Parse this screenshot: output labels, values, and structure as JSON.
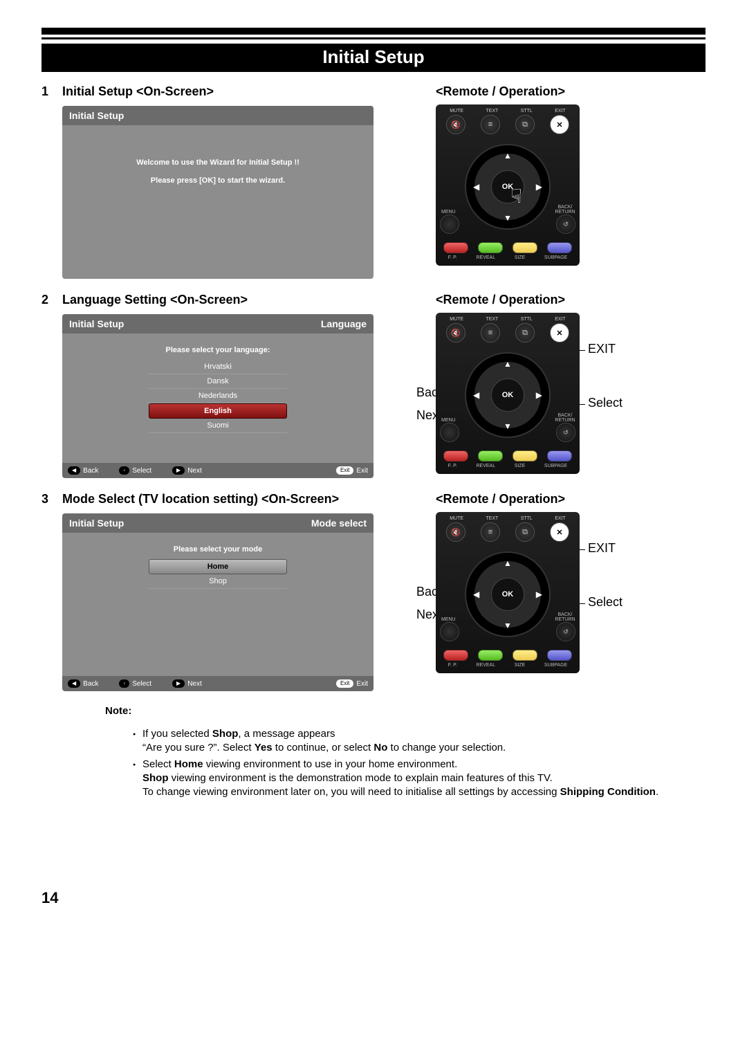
{
  "page_number": "14",
  "title_bar": "Initial Setup",
  "remote_heading": "<Remote / Operation>",
  "step1": {
    "num": "1",
    "heading": "Initial Setup <On-Screen>",
    "osd_title": "Initial Setup",
    "msg1": "Welcome to use the Wizard for Initial Setup !!",
    "msg2": "Please press [OK] to start the wizard."
  },
  "step2": {
    "num": "2",
    "heading": "Language Setting <On-Screen>",
    "osd_title": "Initial Setup",
    "osd_right": "Language",
    "prompt": "Please select your language:",
    "langs": [
      "Hrvatski",
      "Dansk",
      "Nederlands",
      "English",
      "Suomi"
    ],
    "selected": "English"
  },
  "step3": {
    "num": "3",
    "heading": "Mode Select (TV location setting) <On-Screen>",
    "osd_title": "Initial Setup",
    "osd_right": "Mode select",
    "prompt": "Please select your mode",
    "modes": [
      "Home",
      "Shop"
    ],
    "selected": "Home"
  },
  "osd_footer": {
    "back": "Back",
    "select": "Select",
    "next": "Next",
    "exit": "Exit",
    "exit_pill": "Exit"
  },
  "remote": {
    "labels_top": [
      "MUTE",
      "TEXT",
      "STTL",
      "EXIT"
    ],
    "ok": "OK",
    "menu": "MENU",
    "back": "BACK/\nRETURN",
    "labels_bot": [
      "F. P.",
      "REVEAL",
      "SIZE",
      "SUBPAGE"
    ]
  },
  "callouts": {
    "back": "Back",
    "next": "Next",
    "exit": "EXIT",
    "select": "Select"
  },
  "notes": {
    "heading": "Note:",
    "l1a": "If you selected ",
    "l1_shop": "Shop",
    "l1b": ", a message appears",
    "l1c_a": "“Are you sure ?”. Select ",
    "l1c_yes": "Yes",
    "l1c_b": " to continue, or select ",
    "l1c_no": "No",
    "l1c_c": " to change your selection.",
    "l2a": "Select ",
    "l2_home": "Home",
    "l2b": " viewing environment to use in your home environment.",
    "l3_shop": "Shop",
    "l3a": " viewing environment is the demonstration mode to explain main features of this TV.",
    "l4a": "To change viewing environment later on, you will need to initialise all settings by accessing ",
    "l4_sc": "Shipping Condition",
    "l4b": "."
  }
}
